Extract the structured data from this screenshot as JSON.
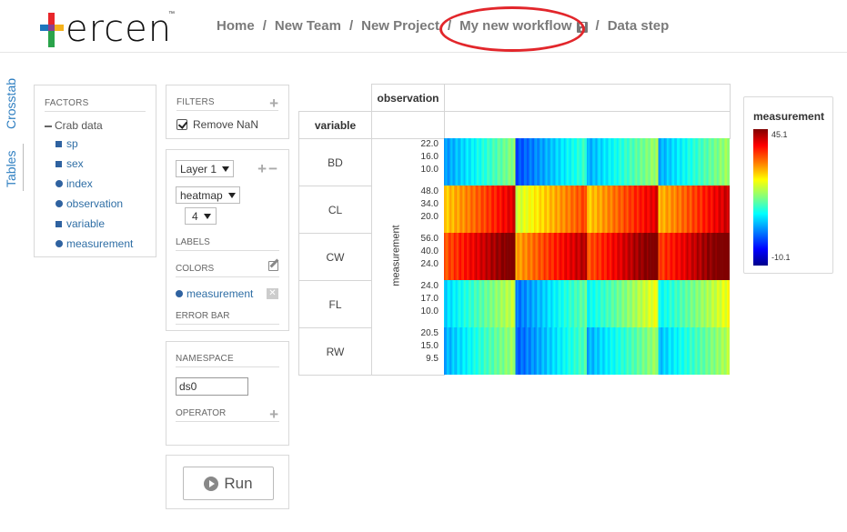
{
  "logo": {
    "text": "ercen",
    "tm": "™"
  },
  "breadcrumb": {
    "items": [
      "Home",
      "New Team",
      "New Project",
      "My new workflow",
      "Data step"
    ],
    "separator": "/"
  },
  "side_tabs": {
    "crosstab": "Crosstab",
    "tables": "Tables"
  },
  "factors": {
    "title": "FACTORS",
    "root": "Crab data",
    "items": [
      {
        "label": "sp",
        "icon": "square-icon"
      },
      {
        "label": "sex",
        "icon": "square-icon"
      },
      {
        "label": "index",
        "icon": "circle-icon"
      },
      {
        "label": "observation",
        "icon": "circle-icon"
      },
      {
        "label": "variable",
        "icon": "square-icon"
      },
      {
        "label": "measurement",
        "icon": "circle-icon"
      }
    ]
  },
  "filters": {
    "title": "FILTERS",
    "remove_nan": "Remove NaN",
    "remove_nan_checked": true
  },
  "layer": {
    "layer_select": "Layer 1",
    "chart_select": "heatmap",
    "size_select": "4",
    "labels_title": "LABELS",
    "colors_title": "COLORS",
    "color_factor": "measurement",
    "error_bar_title": "ERROR BAR"
  },
  "namespace": {
    "title": "NAMESPACE",
    "value": "ds0",
    "operator_title": "OPERATOR"
  },
  "run": {
    "label": "Run"
  },
  "crosstab": {
    "col_header": "observation",
    "row_header": "variable",
    "y_axis_label": "measurement",
    "rows": [
      {
        "label": "BD",
        "ticks": [
          "22.0",
          "16.0",
          "10.0"
        ]
      },
      {
        "label": "CL",
        "ticks": [
          "48.0",
          "34.0",
          "20.0"
        ]
      },
      {
        "label": "CW",
        "ticks": [
          "56.0",
          "40.0",
          "24.0"
        ]
      },
      {
        "label": "FL",
        "ticks": [
          "24.0",
          "17.0",
          "10.0"
        ]
      },
      {
        "label": "RW",
        "ticks": [
          "20.5",
          "15.0",
          "9.5"
        ]
      }
    ]
  },
  "legend": {
    "title": "measurement",
    "max": "45.1",
    "min": "-10.1"
  },
  "colors": {
    "accent": "#2f7fc1",
    "highlight": "#e2262b"
  }
}
